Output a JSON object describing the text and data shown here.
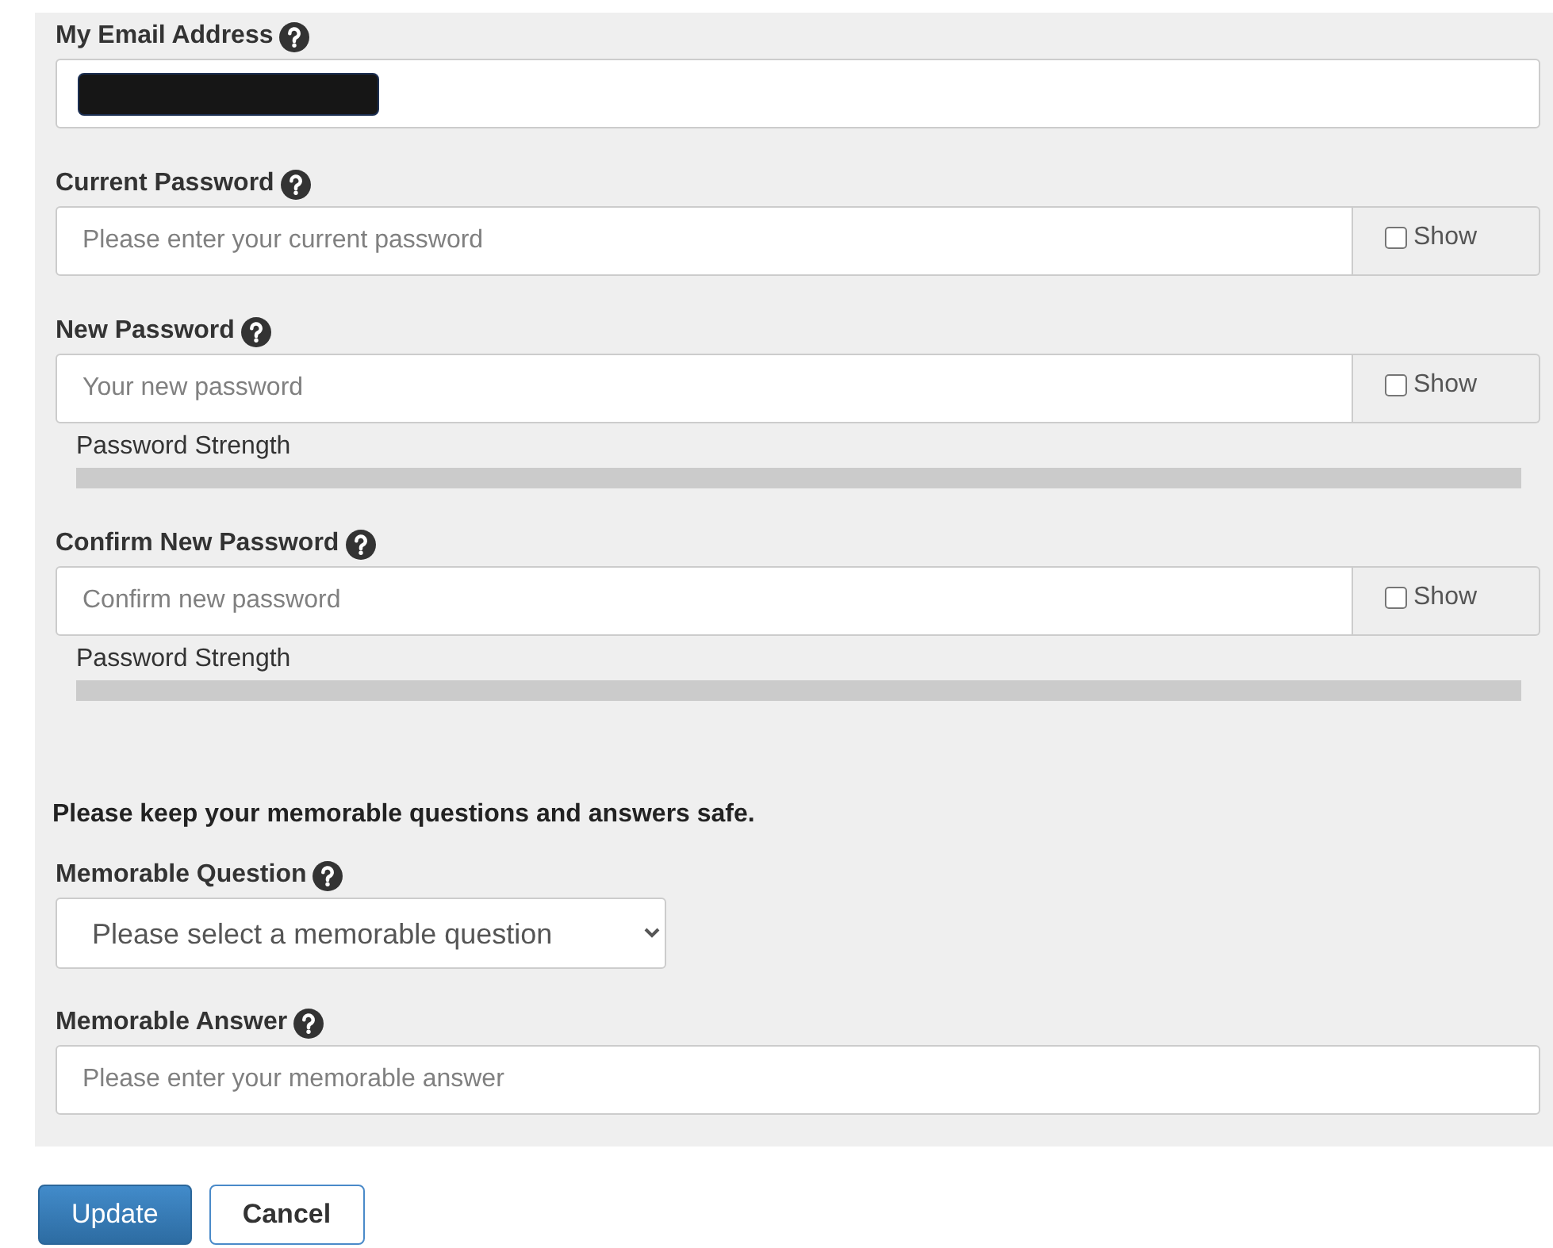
{
  "email": {
    "label": "My Email Address",
    "redacted": true
  },
  "passwords": [
    {
      "label": "Current Password",
      "placeholder": "Please enter your current password",
      "show": {
        "label": "Show",
        "checked": false
      }
    },
    {
      "label": "New Password",
      "placeholder": "Your new password",
      "show": {
        "label": "Show",
        "checked": false
      },
      "strength": {
        "label": "Password Strength",
        "level": 0
      }
    },
    {
      "label": "Confirm New Password",
      "placeholder": "Confirm new password",
      "show": {
        "label": "Show",
        "checked": false
      },
      "strength": {
        "label": "Password Strength",
        "level": 0
      }
    }
  ],
  "memorable": {
    "notice": "Please keep your memorable questions and answers safe.",
    "question": {
      "label": "Memorable Question",
      "placeholder": "Please select a memorable question"
    },
    "answer": {
      "label": "Memorable Answer",
      "placeholder": "Please enter your memorable answer"
    }
  },
  "buttons": [
    {
      "label": "Update",
      "kind": "primary"
    },
    {
      "label": "Cancel",
      "kind": "secondary"
    }
  ]
}
